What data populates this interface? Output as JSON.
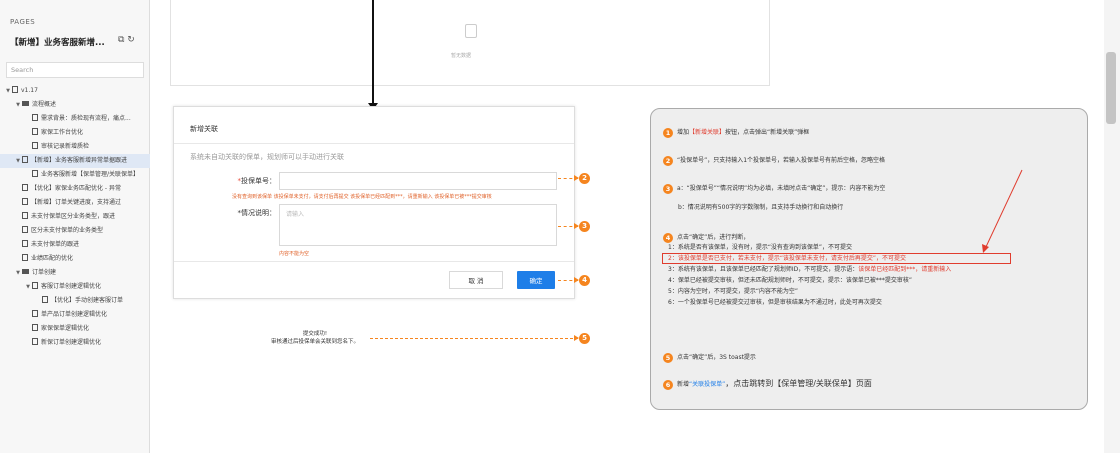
{
  "sidebar": {
    "pages_label": "PAGES",
    "title": "【新增】业务客服新增...",
    "title_icons": "⧉ ↻",
    "search_placeholder": "Search",
    "tree": [
      {
        "depth": 0,
        "toggle": "▼",
        "icon": "page",
        "label": "v1.17"
      },
      {
        "depth": 1,
        "toggle": "▼",
        "icon": "folder",
        "label": "流程概述"
      },
      {
        "depth": 2,
        "toggle": "",
        "icon": "page",
        "label": "需求背景：质检现有流程，痛点..."
      },
      {
        "depth": 2,
        "toggle": "",
        "icon": "page",
        "label": "家保工作台优化"
      },
      {
        "depth": 2,
        "toggle": "",
        "icon": "page",
        "label": "审核记录新增质检"
      },
      {
        "depth": 1,
        "toggle": "▼",
        "icon": "page",
        "label": "【新增】业务客服新增异常单据跟进",
        "selected": true
      },
      {
        "depth": 2,
        "toggle": "",
        "icon": "page",
        "label": "业务客服新增【保单管理/关联保单】"
      },
      {
        "depth": 1,
        "toggle": "",
        "icon": "page",
        "label": "【优化】家保业务匹配优化 - 异常"
      },
      {
        "depth": 1,
        "toggle": "",
        "icon": "page",
        "label": "【新增】订单关键进度，支持通过"
      },
      {
        "depth": 1,
        "toggle": "",
        "icon": "page",
        "label": "未支付保单区分业务类型，跟进"
      },
      {
        "depth": 1,
        "toggle": "",
        "icon": "page",
        "label": "区分未支付保单的业务类型"
      },
      {
        "depth": 1,
        "toggle": "",
        "icon": "page",
        "label": "未支付保单的跟进"
      },
      {
        "depth": 1,
        "toggle": "",
        "icon": "page",
        "label": "业绩匹配的优化"
      },
      {
        "depth": 1,
        "toggle": "▼",
        "icon": "folder",
        "label": "订单创建"
      },
      {
        "depth": 2,
        "toggle": "▼",
        "icon": "page",
        "label": "客服订单创建逻辑优化"
      },
      {
        "depth": 3,
        "toggle": "",
        "icon": "page",
        "label": "【优化】手动创建客服订单"
      },
      {
        "depth": 2,
        "toggle": "",
        "icon": "page",
        "label": "单产品订单创建逻辑优化"
      },
      {
        "depth": 2,
        "toggle": "",
        "icon": "page",
        "label": "家保保单逻辑优化"
      },
      {
        "depth": 2,
        "toggle": "",
        "icon": "page",
        "label": "新保订单创建逻辑优化"
      }
    ]
  },
  "empty_panel": {
    "text": "暂无数据"
  },
  "dialog": {
    "title": "新增关联",
    "description": "系统未自动关联的保单，规划师可以手动进行关联",
    "policy_label": "投保单号：",
    "policy_hint": "没有查询到该保单 该投保单未支付，请支付后再提交 该投保单已经匹配到***，请重新输入 该投保单已被***提交审核",
    "desc_label": "*情况说明：",
    "desc_placeholder": "请输入",
    "desc_error": "内容不能为空",
    "cancel": "取 消",
    "ok": "确定"
  },
  "toast": {
    "line1": "提交成功!",
    "line2": "审核通过后投保单会关联到您名下。"
  },
  "markers": [
    "2",
    "3",
    "4",
    "5"
  ],
  "notes": [
    {
      "num": "1",
      "pre": "增加",
      "hl": "【新增关联】",
      "post": "按钮，点击弹出“新增关联”弹框"
    },
    {
      "num": "2",
      "text": "“投保单号”，只支持输入1个投保单号，若输入投保单号有前后空格，忽略空格"
    },
    {
      "num": "3",
      "text": "a：“投保单号”“情况说明”均为必填，未填时点击“确定”，提示：内容不能为空"
    },
    {
      "text": "b：情况说明有500字的字数限制，且支持手动换行和自动换行"
    },
    {
      "num": "4",
      "text": "点击“确定”后，进行判断，"
    },
    {
      "text": "1：系统是否有该保单，没有时，提示“没有查询到该保单”，不可提交"
    },
    {
      "text": "2：该投保单是否已支付，若未支付，提示“该投保单未支付，请支付后再提交”，不可提交",
      "red": true
    },
    {
      "pre": "3：系统有该保单，且该保单已经匹配了规划师ID，不可提交，提示语：",
      "hl": "该保单已经匹配到***，请重新输入"
    },
    {
      "text": "4：保单已经被提交审核，但还未匹配规划师时，不可提交，提示：该保单已被***提交审核”"
    },
    {
      "text": "5：内容为空时，不可提交，提示“内容不能为空”"
    },
    {
      "text": "6：一个投保单号已经被提交过审核，但是审核结果为不通过时，此处可再次提交"
    },
    {
      "num": "5",
      "text": "点击“确定”后，3S toast提示"
    },
    {
      "num": "6",
      "pre": "新增",
      "hl": "“关联投保单”",
      "post": "，点击跳转到【保单管理/关联保单】页面"
    }
  ],
  "colors": {
    "accent": "#f5851f",
    "primary": "#1e7ee8",
    "error": "#e03c2e"
  }
}
